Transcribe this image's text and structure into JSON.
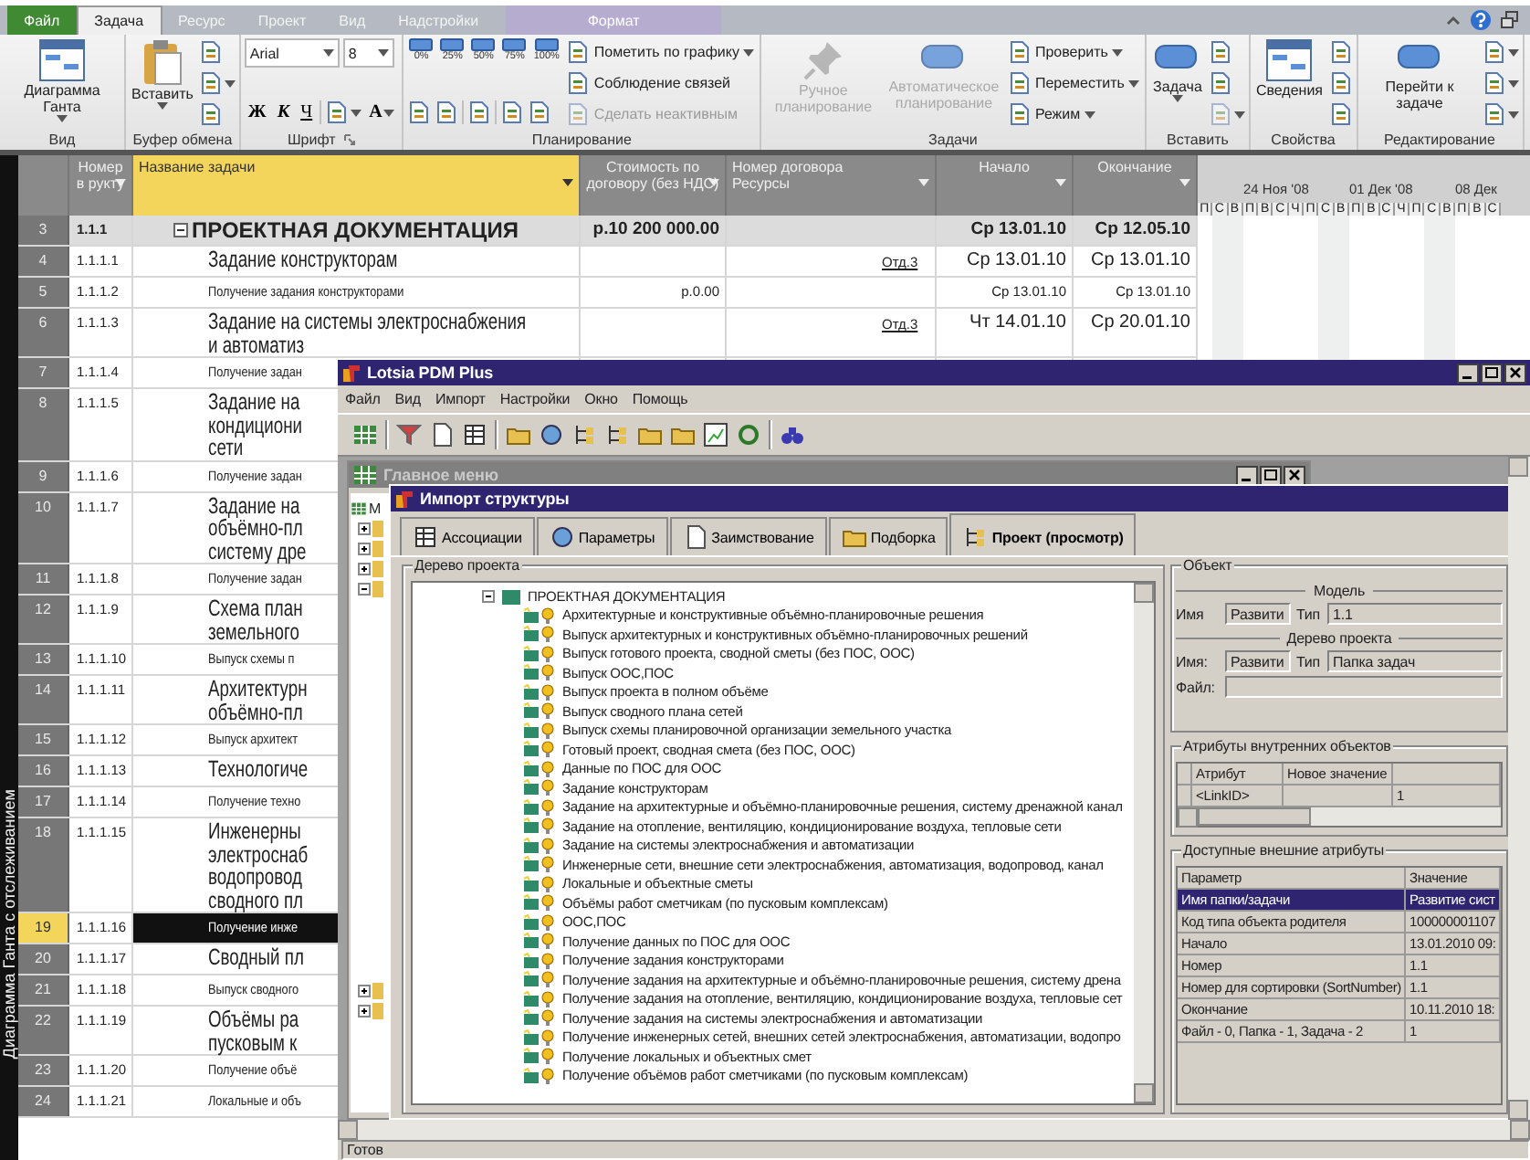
{
  "ribbon": {
    "tabs": [
      {
        "label": "Файл",
        "kind": "file",
        "selected": false
      },
      {
        "label": "Задача",
        "kind": "tab",
        "selected": true
      },
      {
        "label": "Ресурс",
        "kind": "tab",
        "selected": false
      },
      {
        "label": "Проект",
        "kind": "tab",
        "selected": false
      },
      {
        "label": "Вид",
        "kind": "tab",
        "selected": false
      },
      {
        "label": "Надстройки",
        "kind": "tab",
        "selected": false
      },
      {
        "label": "Формат",
        "kind": "context",
        "selected": false
      }
    ],
    "groups": [
      {
        "label": "Вид",
        "launcher": false,
        "columns": [
          [
            [
              {
                "kind": "large",
                "label": "Диаграмма Ганта",
                "dropdown": true,
                "disabled": false
              }
            ]
          ]
        ]
      },
      {
        "label": "Буфер обмена",
        "launcher": false,
        "columns": [
          [
            [
              {
                "kind": "large",
                "label": "Вставить",
                "dropdown": true,
                "disabled": false
              }
            ]
          ],
          [
            [
              {
                "kind": "icon",
                "dropdown": false,
                "disabled": false
              }
            ],
            [
              {
                "kind": "icon",
                "dropdown": true,
                "disabled": false
              }
            ],
            [
              {
                "kind": "icon",
                "dropdown": false,
                "disabled": false
              }
            ]
          ]
        ]
      },
      {
        "label": "Шрифт",
        "launcher": true,
        "columns": [
          [
            [
              {
                "kind": "combo",
                "value": "Arial"
              },
              {
                "kind": "combo",
                "value": "8"
              }
            ],
            [
              {
                "kind": "char",
                "label": "Ж",
                "dropdown": false
              },
              {
                "kind": "char",
                "label": "К",
                "dropdown": false
              },
              {
                "kind": "char",
                "label": "Ч",
                "dropdown": false
              },
              {
                "kind": "separator"
              },
              {
                "kind": "icon",
                "dropdown": true,
                "disabled": false
              },
              {
                "kind": "char",
                "label": "A",
                "dropdown": true
              }
            ]
          ]
        ]
      },
      {
        "label": "Планирование",
        "launcher": false,
        "columns": [
          [
            [
              {
                "kind": "pct",
                "label": "0%"
              },
              {
                "kind": "pct",
                "label": "25%"
              },
              {
                "kind": "pct",
                "label": "50%"
              },
              {
                "kind": "pct",
                "label": "75%"
              },
              {
                "kind": "pct",
                "label": "100%"
              }
            ],
            [
              {
                "kind": "icon",
                "dropdown": false,
                "disabled": false
              },
              {
                "kind": "icon",
                "dropdown": false,
                "disabled": false
              },
              {
                "kind": "separator"
              },
              {
                "kind": "icon",
                "dropdown": false,
                "disabled": false
              },
              {
                "kind": "separator"
              },
              {
                "kind": "icon",
                "dropdown": false,
                "disabled": false
              },
              {
                "kind": "icon",
                "dropdown": false,
                "disabled": false
              }
            ]
          ],
          [
            [
              {
                "kind": "small",
                "label": "Пометить по графику",
                "dropdown": true,
                "disabled": false
              }
            ],
            [
              {
                "kind": "small",
                "label": "Соблюдение связей",
                "dropdown": false,
                "disabled": false
              }
            ],
            [
              {
                "kind": "small",
                "label": "Сделать неактивным",
                "dropdown": false,
                "disabled": true
              }
            ]
          ]
        ]
      },
      {
        "label": "Задачи",
        "launcher": false,
        "columns": [
          [
            [
              {
                "kind": "large",
                "label": "Ручное планирование",
                "dropdown": false,
                "disabled": true
              }
            ]
          ],
          [
            [
              {
                "kind": "large",
                "label": "Автоматическое планирование",
                "dropdown": false,
                "disabled": true
              }
            ]
          ],
          [
            [
              {
                "kind": "small",
                "label": "Проверить",
                "dropdown": true,
                "disabled": false
              }
            ],
            [
              {
                "kind": "small",
                "label": "Переместить",
                "dropdown": true,
                "disabled": false
              }
            ],
            [
              {
                "kind": "small",
                "label": "Режим",
                "dropdown": true,
                "disabled": false
              }
            ]
          ]
        ]
      },
      {
        "label": "Вставить",
        "launcher": false,
        "columns": [
          [
            [
              {
                "kind": "large",
                "label": "Задача",
                "dropdown": true,
                "disabled": false
              }
            ]
          ],
          [
            [
              {
                "kind": "icon",
                "dropdown": false,
                "disabled": false
              }
            ],
            [
              {
                "kind": "icon",
                "dropdown": false,
                "disabled": false
              }
            ],
            [
              {
                "kind": "icon",
                "dropdown": true,
                "disabled": true
              }
            ]
          ]
        ]
      },
      {
        "label": "Свойства",
        "launcher": false,
        "columns": [
          [
            [
              {
                "kind": "large",
                "label": "Сведения",
                "dropdown": false,
                "disabled": false
              }
            ]
          ],
          [
            [
              {
                "kind": "icon",
                "dropdown": false,
                "disabled": false
              }
            ],
            [
              {
                "kind": "icon",
                "dropdown": false,
                "disabled": false
              }
            ],
            [
              {
                "kind": "icon",
                "dropdown": false,
                "disabled": false
              }
            ]
          ]
        ]
      },
      {
        "label": "Редактирование",
        "launcher": false,
        "columns": [
          [
            [
              {
                "kind": "large",
                "label": "Перейти к задаче",
                "dropdown": false,
                "disabled": false
              }
            ]
          ],
          [
            [
              {
                "kind": "icon",
                "dropdown": true,
                "disabled": false
              }
            ],
            [
              {
                "kind": "icon",
                "dropdown": true,
                "disabled": false
              }
            ],
            [
              {
                "kind": "icon",
                "dropdown": true,
                "disabled": false
              }
            ]
          ]
        ]
      }
    ]
  },
  "sheet": {
    "side_label": "Диаграмма Ганта с отслеживанием",
    "columns": [
      {
        "label": "Номер в рукту",
        "selected": false
      },
      {
        "label": "Название задачи",
        "selected": true
      },
      {
        "label": "Стоимость по договору (без НДС)",
        "selected": false
      },
      {
        "label": "Номер договора",
        "sublabel": "Ресурсы",
        "selected": false
      },
      {
        "label": "Начало",
        "selected": false
      },
      {
        "label": "Окончание",
        "selected": false
      }
    ],
    "rows": [
      {
        "num": "3",
        "wbs": "1.1.1",
        "kind": "group",
        "expanded": true,
        "lines": [
          "ПРОЕКТНАЯ ДОКУМЕНТАЦИЯ"
        ],
        "cost": "р.10 200 000.00",
        "start": "Ср 13.01.10",
        "end": "Ср 12.05.10",
        "selected": false
      },
      {
        "num": "4",
        "wbs": "1.1.1.1",
        "kind": "summary",
        "lines": [
          "Задание конструкторам"
        ],
        "resource": "Отд.3",
        "start": "Ср 13.01.10",
        "end": "Ср 13.01.10",
        "selected": false
      },
      {
        "num": "5",
        "wbs": "1.1.1.2",
        "kind": "task",
        "lines": [
          "Получение задания конструкторами"
        ],
        "cost": "р.0.00",
        "start": "Ср 13.01.10",
        "end": "Ср 13.01.10",
        "selected": false
      },
      {
        "num": "6",
        "wbs": "1.1.1.3",
        "kind": "summary",
        "lines": [
          "Задание на системы электроснабжения",
          "и автоматиз"
        ],
        "resource": "Отд.3",
        "start": "Чт 14.01.10",
        "end": "Ср 20.01.10",
        "selected": false
      },
      {
        "num": "7",
        "wbs": "1.1.1.4",
        "kind": "task",
        "lines": [
          "Получение задан"
        ],
        "selected": false
      },
      {
        "num": "8",
        "wbs": "1.1.1.5",
        "kind": "summary",
        "lines": [
          "Задание на",
          "кондициони",
          "сети"
        ],
        "selected": false
      },
      {
        "num": "9",
        "wbs": "1.1.1.6",
        "kind": "task",
        "lines": [
          "Получение задан"
        ],
        "selected": false
      },
      {
        "num": "10",
        "wbs": "1.1.1.7",
        "kind": "summary",
        "lines": [
          "Задание на",
          "объёмно-пл",
          "систему дре"
        ],
        "selected": false
      },
      {
        "num": "11",
        "wbs": "1.1.1.8",
        "kind": "task",
        "lines": [
          "Получение задан"
        ],
        "selected": false
      },
      {
        "num": "12",
        "wbs": "1.1.1.9",
        "kind": "summary",
        "lines": [
          "Схема план",
          "земельного"
        ],
        "selected": false
      },
      {
        "num": "13",
        "wbs": "1.1.1.10",
        "kind": "task",
        "lines": [
          "Выпуск схемы п"
        ],
        "selected": false
      },
      {
        "num": "14",
        "wbs": "1.1.1.11",
        "kind": "summary",
        "lines": [
          "Архитектурн",
          "объёмно-пл"
        ],
        "selected": false
      },
      {
        "num": "15",
        "wbs": "1.1.1.12",
        "kind": "task",
        "lines": [
          "Выпуск архитект"
        ],
        "selected": false
      },
      {
        "num": "16",
        "wbs": "1.1.1.13",
        "kind": "summary",
        "lines": [
          "Технологиче"
        ],
        "selected": false
      },
      {
        "num": "17",
        "wbs": "1.1.1.14",
        "kind": "task",
        "lines": [
          "Получение техно"
        ],
        "selected": false
      },
      {
        "num": "18",
        "wbs": "1.1.1.15",
        "kind": "summary",
        "lines": [
          "Инженерны",
          "электроснаб",
          "водопровод",
          "сводного пл"
        ],
        "selected": false
      },
      {
        "num": "19",
        "wbs": "1.1.1.16",
        "kind": "task",
        "lines": [
          "Получение инже"
        ],
        "selected": true
      },
      {
        "num": "20",
        "wbs": "1.1.1.17",
        "kind": "summary",
        "lines": [
          "Сводный пл"
        ],
        "selected": false
      },
      {
        "num": "21",
        "wbs": "1.1.1.18",
        "kind": "task",
        "lines": [
          "Выпуск сводного"
        ],
        "selected": false
      },
      {
        "num": "22",
        "wbs": "1.1.1.19",
        "kind": "summary",
        "lines": [
          "Объёмы ра",
          "пусковым к"
        ],
        "selected": false
      },
      {
        "num": "23",
        "wbs": "1.1.1.20",
        "kind": "task",
        "lines": [
          "Получение объё"
        ],
        "selected": false
      },
      {
        "num": "24",
        "wbs": "1.1.1.21",
        "kind": "task",
        "lines": [
          "Локальные и объ"
        ],
        "selected": false
      }
    ]
  },
  "gantt": {
    "weeks": [
      "24 Ноя '08",
      "01 Дек '08",
      "08 Дек"
    ],
    "days": [
      {
        "label": "П",
        "weekend": false
      },
      {
        "label": "С",
        "weekend": true
      },
      {
        "label": "В",
        "weekend": true
      },
      {
        "label": "П",
        "weekend": false
      },
      {
        "label": "В",
        "weekend": false
      },
      {
        "label": "С",
        "weekend": false
      },
      {
        "label": "Ч",
        "weekend": false
      },
      {
        "label": "П",
        "weekend": false
      },
      {
        "label": "С",
        "weekend": true
      },
      {
        "label": "В",
        "weekend": true
      },
      {
        "label": "П",
        "weekend": false
      },
      {
        "label": "В",
        "weekend": false
      },
      {
        "label": "С",
        "weekend": false
      },
      {
        "label": "Ч",
        "weekend": false
      },
      {
        "label": "П",
        "weekend": false
      },
      {
        "label": "С",
        "weekend": true
      },
      {
        "label": "В",
        "weekend": true
      },
      {
        "label": "П",
        "weekend": false
      },
      {
        "label": "В",
        "weekend": false
      },
      {
        "label": "С",
        "weekend": false
      }
    ]
  },
  "pdm_window": {
    "title": "Lotsia PDM Plus",
    "menu": [
      "Файл",
      "Вид",
      "Импорт",
      "Настройки",
      "Окно",
      "Помощь"
    ],
    "status": "Готов",
    "child": {
      "title": "Главное меню",
      "root_label": "М",
      "nodes": [
        {
          "expanded": false
        },
        {
          "expanded": false
        },
        {
          "expanded": false
        },
        {
          "expanded": true
        },
        {
          "expanded": false
        },
        {
          "expanded": false
        }
      ]
    },
    "dialog": {
      "title": "Импорт структуры",
      "tabs": [
        {
          "label": "Ассоциации",
          "selected": false
        },
        {
          "label": "Параметры",
          "selected": false
        },
        {
          "label": "Заимствование",
          "selected": false
        },
        {
          "label": "Подборка",
          "selected": false
        },
        {
          "label": "Проект (просмотр)",
          "selected": true
        }
      ],
      "tree_title": "Дерево проекта",
      "tree": {
        "label": "ПРОЕКТНАЯ ДОКУМЕНТАЦИЯ",
        "expanded": true,
        "children": [
          {
            "label": "Архитектурные и конструктивные объёмно-планировочные решения"
          },
          {
            "label": "Выпуск архитектурных и конструктивных  объёмно-планировочных решений"
          },
          {
            "label": "Выпуск готового проекта, сводной сметы (без ПОС, ООС)"
          },
          {
            "label": "Выпуск ООС,ПОС"
          },
          {
            "label": "Выпуск проекта в полном объёме"
          },
          {
            "label": "Выпуск сводного плана сетей"
          },
          {
            "label": "Выпуск схемы планировочной организации земельного участка"
          },
          {
            "label": "Готовый проект, сводная смета (без ПОС, ООС)"
          },
          {
            "label": "Данные по ПОС для ООС"
          },
          {
            "label": "Задание конструкторам"
          },
          {
            "label": "Задание на архитектурные и объёмно-планировочные решения, систему дренажной канал"
          },
          {
            "label": "Задание на отопление, вентиляцию, кондиционирование воздуха, тепловые сети"
          },
          {
            "label": "Задание на системы электроснабжения и автоматизации"
          },
          {
            "label": "Инженерные сети, внешние сети электроснабжения, автоматизация, водопровод, канал"
          },
          {
            "label": "Локальные и объектные сметы"
          },
          {
            "label": "Объёмы работ сметчикам (по пусковым комплексам)"
          },
          {
            "label": "ООС,ПОС"
          },
          {
            "label": "Получение данных по ПОС для ООС"
          },
          {
            "label": "Получение задания конструкторами"
          },
          {
            "label": "Получение задания на архитектурные и объёмно-планировочные решения, систему дрена"
          },
          {
            "label": "Получение задания на отопление, вентиляцию, кондиционирование воздуха, тепловые сет"
          },
          {
            "label": "Получение задания на системы электроснабжения и автоматизации"
          },
          {
            "label": "Получение инженерных сетей, внешних сетей электроснабжения, автоматизации, водопро"
          },
          {
            "label": "Получение локальных и объектных смет"
          },
          {
            "label": "Получение объёмов работ сметчиками (по пусковым комплексам)"
          }
        ]
      },
      "object": {
        "title": "Объект",
        "model_title": "Модель",
        "model": {
          "name_label": "Имя",
          "name": "Развити",
          "type_label": "Тип",
          "type": "1.1"
        },
        "tree_title": "Дерево проекта",
        "tree_obj": {
          "name_label": "Имя:",
          "name": "Развити",
          "type_label": "Тип",
          "type": "Папка задач"
        },
        "file_label": "Файл:"
      },
      "internal": {
        "title": "Атрибуты внутренних объектов",
        "columns": [
          "Атрибут",
          "Новое значение"
        ],
        "rows": [
          {
            "attribute": "<LinkID>",
            "column_3": "1"
          }
        ]
      },
      "external": {
        "title": "Доступные внешние атрибуты",
        "columns": [
          "Параметр",
          "Значение"
        ],
        "rows": [
          {
            "param": "Имя папки/задачи",
            "value": "Развитие сист",
            "selected": true
          },
          {
            "param": "Код типа объекта родителя",
            "value": "100000001107",
            "selected": false
          },
          {
            "param": "Начало",
            "value": "13.01.2010 09:",
            "selected": false
          },
          {
            "param": "Номер",
            "value": "1.1",
            "selected": false
          },
          {
            "param": "Номер для сортировки (SortNumber)",
            "value": "1.1",
            "selected": false
          },
          {
            "param": "Окончание",
            "value": "10.11.2010 18:",
            "selected": false
          },
          {
            "param": "Файл - 0, Папка - 1, Задача - 2",
            "value": "1",
            "selected": false
          }
        ]
      }
    }
  }
}
